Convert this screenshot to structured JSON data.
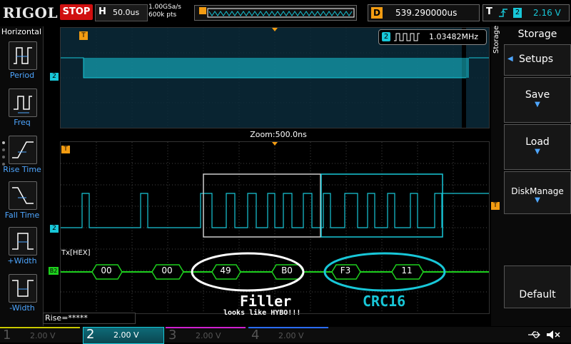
{
  "brand": "RIGOL",
  "run_state": "STOP",
  "horizontal": {
    "label": "H",
    "timebase": "50.0us"
  },
  "acquisition": {
    "sample_rate": "1.00GSa/s",
    "memory_depth": "600k pts"
  },
  "delay": {
    "label": "D",
    "value": "539.290000us"
  },
  "trigger": {
    "label": "T",
    "channel": "2",
    "level": "2.16 V"
  },
  "left_menu": {
    "title": "Horizontal",
    "items": [
      {
        "label": "Period",
        "icon": "period-icon"
      },
      {
        "label": "Freq",
        "icon": "frequency-icon"
      },
      {
        "label": "Rise Time",
        "icon": "rise-time-icon"
      },
      {
        "label": "Fall Time",
        "icon": "fall-time-icon"
      },
      {
        "label": "+Width",
        "icon": "positive-width-icon"
      },
      {
        "label": "-Width",
        "icon": "negative-width-icon"
      }
    ]
  },
  "right_menu": {
    "title": "Storage",
    "side_label": "Storage",
    "items": [
      {
        "label": "Setups"
      },
      {
        "label": "Save"
      },
      {
        "label": "Load"
      },
      {
        "label": "DiskManage"
      },
      {
        "label": "Default"
      }
    ]
  },
  "frequency_readout": {
    "channel": "2",
    "value": "1.03482MHz"
  },
  "zoom_label": "Zoom:500.0ns",
  "decoder": {
    "label": "Tx[HEX]",
    "marker": "B2",
    "bytes": [
      "00",
      "00",
      "49",
      "B0",
      "F3",
      "11"
    ]
  },
  "annotations": {
    "filler": "Filler",
    "filler_note": "looks like HYBO!!!",
    "crc": "CRC16"
  },
  "measurement": "Rise=*****",
  "markers": {
    "trigger": "T",
    "channel2": "2"
  },
  "channels": [
    {
      "number": "1",
      "scale": "2.00 V",
      "color": "#c8c800",
      "active": false
    },
    {
      "number": "2",
      "scale": "2.00 V",
      "color": "#18c7d8",
      "active": true
    },
    {
      "number": "3",
      "scale": "2.00 V",
      "color": "#d020d0",
      "active": false
    },
    {
      "number": "4",
      "scale": "2.00 V",
      "color": "#2a6cff",
      "active": false
    }
  ],
  "colors": {
    "ch2": "#18c7d8",
    "decode": "#1ed01e",
    "trigger": "#f39c12",
    "accent": "#4ea6ff"
  }
}
